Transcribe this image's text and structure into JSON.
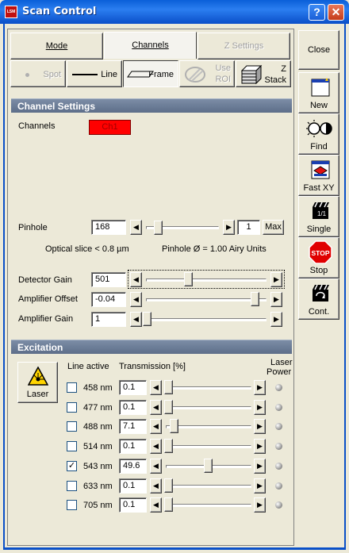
{
  "window": {
    "title": "Scan Control",
    "help_label": "?",
    "close_label": "✕",
    "app_icon": "LSM"
  },
  "tabs": [
    {
      "label": "Mode",
      "state": "normal"
    },
    {
      "label": "Channels",
      "state": "active"
    },
    {
      "label": "Z Settings",
      "state": "disabled"
    }
  ],
  "modes": {
    "spot": "Spot",
    "line": "Line",
    "frame": "Frame",
    "use_roi_1": "Use",
    "use_roi_2": "ROI",
    "z_stack_1": "Z",
    "z_stack_2": "Stack"
  },
  "channel_settings": {
    "header": "Channel Settings",
    "channels_label": "Channels",
    "channel_button": "Ch1",
    "channel_color": "#ff0000",
    "pinhole_label": "Pinhole",
    "pinhole_value": "168",
    "pinhole_step": "1",
    "max_label": "Max",
    "optical_slice": "Optical slice < 0.8 µm",
    "pinhole_airy": "Pinhole Ø = 1.00 Airy Units",
    "detector_gain_label": "Detector Gain",
    "detector_gain_value": "501",
    "amp_offset_label": "Amplifier Offset",
    "amp_offset_value": "-0.04",
    "amp_gain_label": "Amplifier Gain",
    "amp_gain_value": "1"
  },
  "excitation": {
    "header": "Excitation",
    "laser_button": "Laser",
    "col_line_active": "Line active",
    "col_transmission": "Transmission [%]",
    "col_power_1": "Laser",
    "col_power_2": "Power",
    "lines": [
      {
        "wavelength": "458 nm",
        "checked": false,
        "check_mark": "",
        "transmission": "0.1",
        "slider_level": 0.001
      },
      {
        "wavelength": "477 nm",
        "checked": false,
        "check_mark": "",
        "transmission": "0.1",
        "slider_level": 0.001
      },
      {
        "wavelength": "488 nm",
        "checked": false,
        "check_mark": "",
        "transmission": "7.1",
        "slider_level": 0.071
      },
      {
        "wavelength": "514 nm",
        "checked": false,
        "check_mark": "",
        "transmission": "0.1",
        "slider_level": 0.001
      },
      {
        "wavelength": "543 nm",
        "checked": true,
        "check_mark": "✓",
        "transmission": "49.6",
        "slider_level": 0.496
      },
      {
        "wavelength": "633 nm",
        "checked": false,
        "check_mark": "",
        "transmission": "0.1",
        "slider_level": 0.001
      },
      {
        "wavelength": "705 nm",
        "checked": false,
        "check_mark": "",
        "transmission": "0.1",
        "slider_level": 0.001
      }
    ]
  },
  "sidebar": {
    "close": "Close",
    "new": "New",
    "find": "Find",
    "fast_xy": "Fast XY",
    "single": "Single",
    "stop": "Stop",
    "stop_sign": "STOP",
    "cont": "Cont."
  }
}
